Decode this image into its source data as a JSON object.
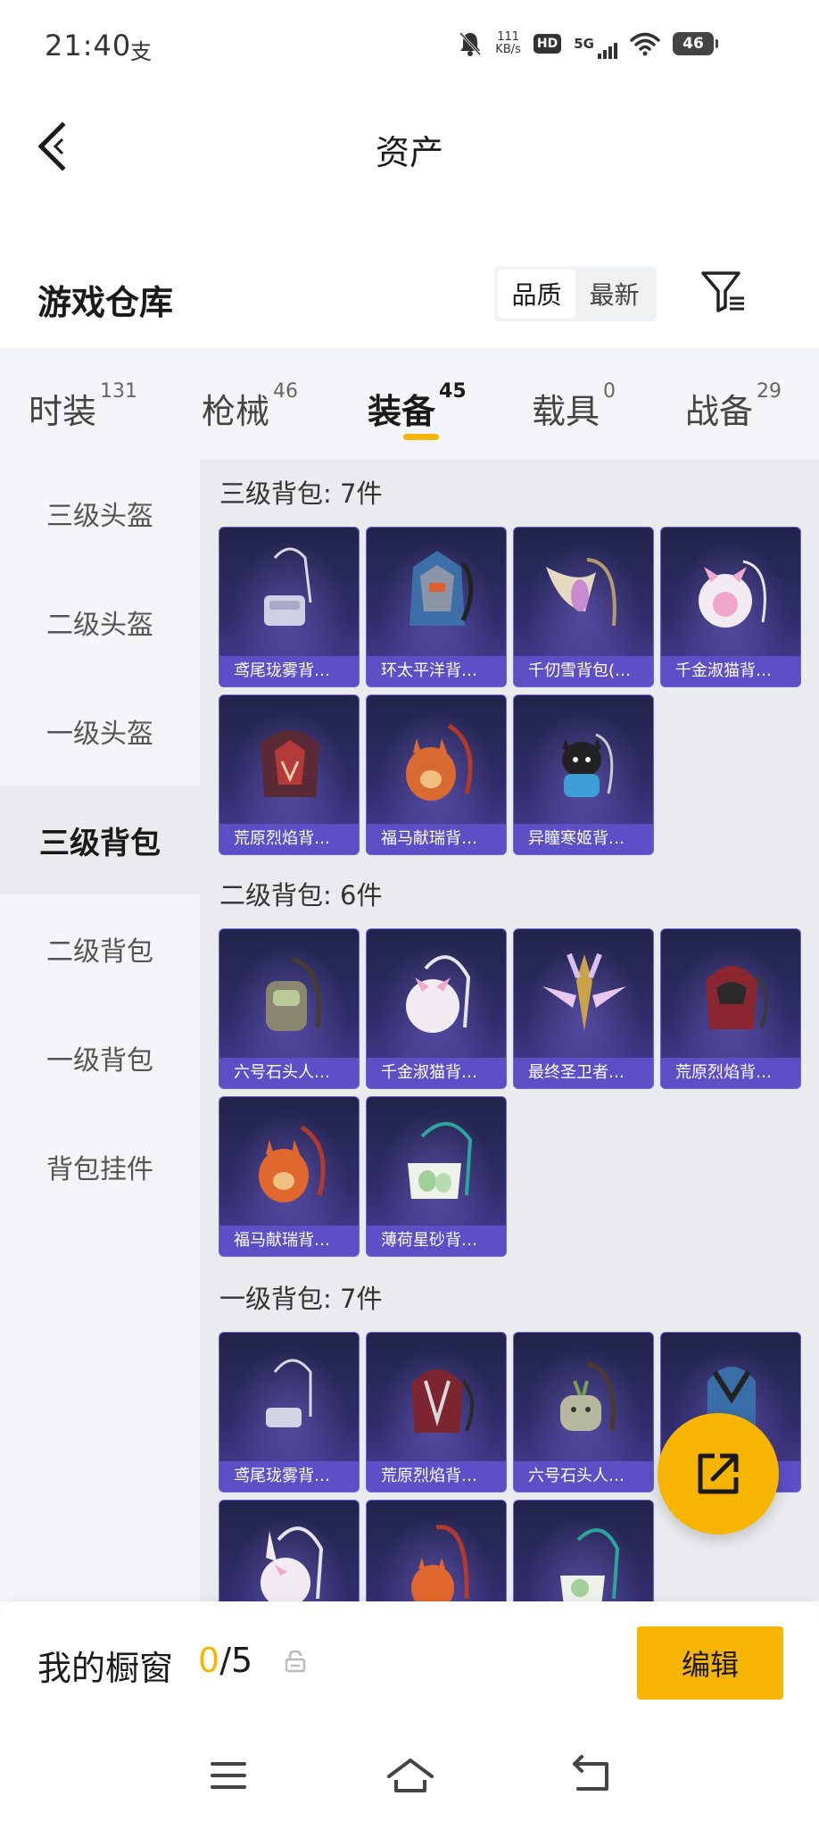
{
  "status_bar": {
    "time": "21:40",
    "alipay_glyph": "支",
    "speed_value": "111",
    "speed_unit": "KB/s",
    "hd": "HD",
    "network": "5G",
    "battery": "46"
  },
  "header": {
    "title": "资产"
  },
  "warehouse": {
    "title": "游戏仓库",
    "sort_options": [
      "品质",
      "最新"
    ],
    "active_sort": "品质"
  },
  "tabs": [
    {
      "label": "时装",
      "count": "131",
      "active": false
    },
    {
      "label": "枪械",
      "count": "46",
      "active": false
    },
    {
      "label": "装备",
      "count": "45",
      "active": true
    },
    {
      "label": "载具",
      "count": "0",
      "active": false
    },
    {
      "label": "战备",
      "count": "29",
      "active": false
    }
  ],
  "sidebar": {
    "items": [
      {
        "label": "三级头盔",
        "active": false
      },
      {
        "label": "二级头盔",
        "active": false
      },
      {
        "label": "一级头盔",
        "active": false
      },
      {
        "label": "三级背包",
        "active": true
      },
      {
        "label": "二级背包",
        "active": false
      },
      {
        "label": "一级背包",
        "active": false
      },
      {
        "label": "背包挂件",
        "active": false
      }
    ]
  },
  "sections": [
    {
      "title": "三级背包: 7件",
      "items": [
        "鸢尾珑雾背…",
        "环太平洋背…",
        "千仞雪背包(…",
        "千金淑猫背…",
        "荒原烈焰背…",
        "福马献瑞背…",
        "异瞳寒姬背…"
      ]
    },
    {
      "title": "二级背包: 6件",
      "items": [
        "六号石头人…",
        "千金淑猫背…",
        "最终圣卫者…",
        "荒原烈焰背…",
        "福马献瑞背…",
        "薄荷星砂背…"
      ]
    },
    {
      "title": "一级背包: 7件",
      "items": [
        "鸢尾珑雾背…",
        "荒原烈焰背…",
        "六号石头人…",
        "",
        "",
        "",
        ""
      ]
    }
  ],
  "showcase": {
    "title": "我的橱窗",
    "current": "0",
    "total": "/5",
    "edit_label": "编辑"
  },
  "icons": {
    "back": "back-arrow-icon",
    "filter": "filter-icon",
    "fab": "share-export-icon",
    "lock": "lock-icon",
    "nav_menu": "menu-icon",
    "nav_home": "home-icon",
    "nav_back": "back-icon"
  },
  "colors": {
    "accent": "#f7b400",
    "card_label_bg": "#5d4fc6",
    "card_bg": "#2f2c68"
  }
}
